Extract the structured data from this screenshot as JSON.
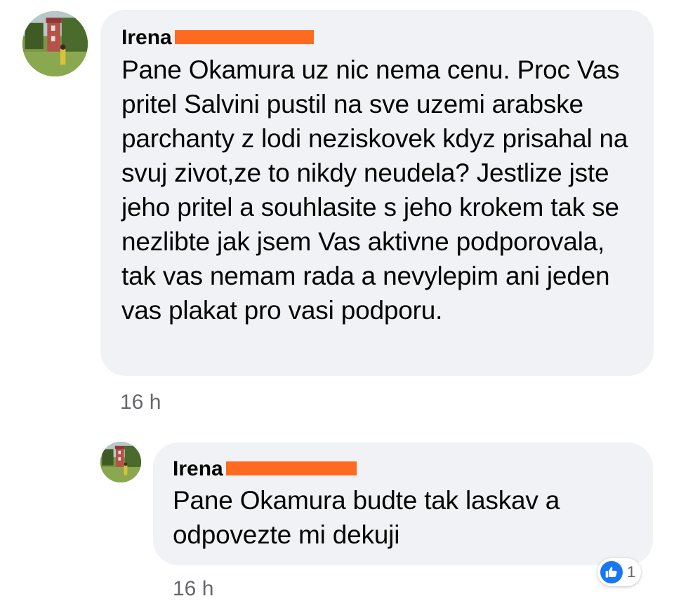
{
  "comments": [
    {
      "author_first_name": "Irena",
      "text": "Pane Okamura uz nic nema cenu. Proc Vas pritel Salvini pustil na sve uzemi arabske parchanty z lodi neziskovek kdyz prisahal na svuj zivot,ze to nikdy neudela? Jestlize jste jeho pritel a souhlasite s jeho krokem tak se nezlibte jak jsem Vas aktivne podporovala, tak vas nemam rada a nevylepim ani jeden vas plakat pro vasi podporu.",
      "time": "16 h"
    }
  ],
  "reply": {
    "author_first_name": "Irena",
    "text": "Pane Okamura budte tak laskav a odpovezte mi dekuji",
    "time": "16 h",
    "reactions": {
      "icon": "like-icon",
      "count": "1",
      "color": "#1877f2"
    }
  },
  "colors": {
    "bubble": "#f0f2f5",
    "redaction": "#ff6a21",
    "secondary_text": "#65676b"
  }
}
